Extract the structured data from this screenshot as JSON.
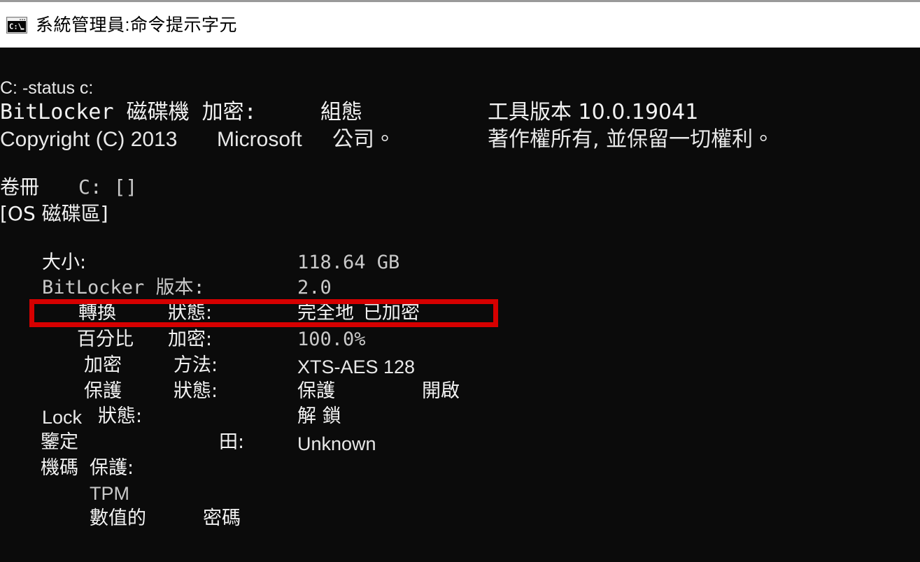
{
  "window": {
    "title": "系統管理員:命令提示字元",
    "icon": "console-icon",
    "icon_label": "C:\\"
  },
  "terminal": {
    "background": "#0b0b0b",
    "foreground": "#e8e8e8",
    "prompt_line": "C: -status c:",
    "banner": {
      "line1_left": "BitLocker 磁碟機 加密:",
      "line1_mid": "組態",
      "line1_right": "工具版本 10.0.19041",
      "line2_left": "Copyright (C) 2013",
      "line2_mid": "Microsoft",
      "line2_mid2": "公司。",
      "line2_right": "著作權所有, 並保留一切權利。"
    },
    "volume": {
      "label": "卷冊",
      "drive": "C: []",
      "description": "[OS 磁碟區]"
    },
    "rows": [
      {
        "label": "大小:",
        "value": "118.64 GB"
      },
      {
        "label": "BitLocker 版本:",
        "value": "2.0"
      },
      {
        "label_a": "轉換",
        "label_b": "狀態:",
        "value_a": "完全地",
        "value_b": "已加密"
      },
      {
        "label_a": "百分比",
        "label_b": "加密:",
        "value": "100.0%"
      },
      {
        "label_a": "加密",
        "label_b": "方法:",
        "value": "XTS-AES 128"
      },
      {
        "label_a": "保護",
        "label_b": "狀態:",
        "value_a": "保護",
        "value_b": "開啟"
      },
      {
        "label_a": "Lock",
        "label_b": "狀態:",
        "value": "解 鎖"
      },
      {
        "label_a": "鑒定",
        "label_b": "田:",
        "value": "Unknown"
      },
      {
        "label_a": "機碼",
        "label_b": "保護:",
        "value": ""
      },
      {
        "label": "TPM",
        "value": ""
      },
      {
        "label_a": "數值的",
        "label_b": "密碼",
        "value": ""
      }
    ]
  },
  "annotation": {
    "highlight_color": "#d60000",
    "highlight_target": "轉換 狀態: 完全地 已加密"
  }
}
